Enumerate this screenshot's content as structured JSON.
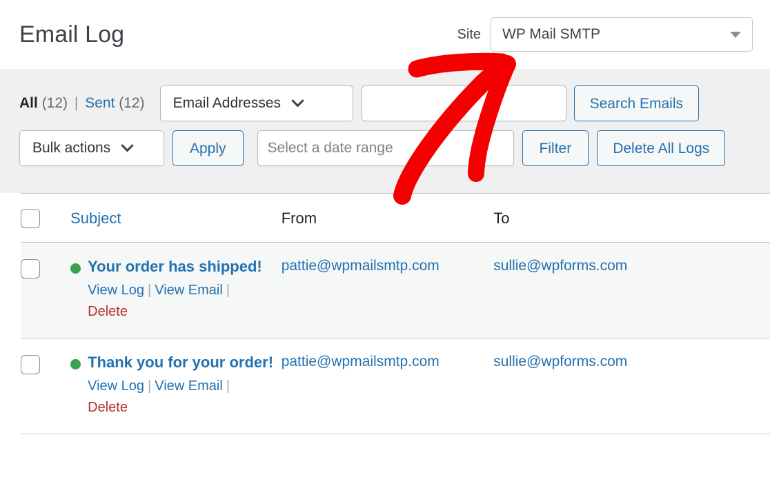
{
  "header": {
    "title": "Email Log",
    "site_label": "Site",
    "site_value": "WP Mail SMTP",
    "site_caret_icon": "chevron-down-icon"
  },
  "toolbar": {
    "views": {
      "all_label": "All",
      "all_count": "(12)",
      "separator": "|",
      "sent_label": "Sent",
      "sent_count": "(12)"
    },
    "email_addresses_select": {
      "value": "Email Addresses",
      "caret_icon": "chevron-down-icon"
    },
    "search_input": {
      "value": "",
      "placeholder": ""
    },
    "search_button_label": "Search Emails",
    "bulk_actions_select": {
      "value": "Bulk actions",
      "caret_icon": "chevron-down-icon"
    },
    "apply_button_label": "Apply",
    "date_range_input": {
      "value": "",
      "placeholder": "Select a date range"
    },
    "filter_button_label": "Filter",
    "delete_all_logs_button_label": "Delete All Logs"
  },
  "table": {
    "columns": {
      "subject": "Subject",
      "from": "From",
      "to": "To"
    },
    "rows": [
      {
        "status": "sent",
        "status_color": "#3ba14f",
        "subject": "Your order has shipped!",
        "from": "pattie@wpmailsmtp.com",
        "to": "sullie@wpforms.com",
        "actions": {
          "view_log": "View Log",
          "view_email": "View Email",
          "delete": "Delete"
        }
      },
      {
        "status": "sent",
        "status_color": "#3ba14f",
        "subject": "Thank you for your order!",
        "from": "pattie@wpmailsmtp.com",
        "to": "sullie@wpforms.com",
        "actions": {
          "view_log": "View Log",
          "view_email": "View Email",
          "delete": "Delete"
        }
      }
    ]
  },
  "annotation": {
    "type": "arrow",
    "color": "#f50000",
    "points_to": "site-select"
  },
  "colors": {
    "link": "#2271b1",
    "delete": "#b32d2e",
    "status_sent": "#3ba14f",
    "annotation": "#f50000"
  }
}
